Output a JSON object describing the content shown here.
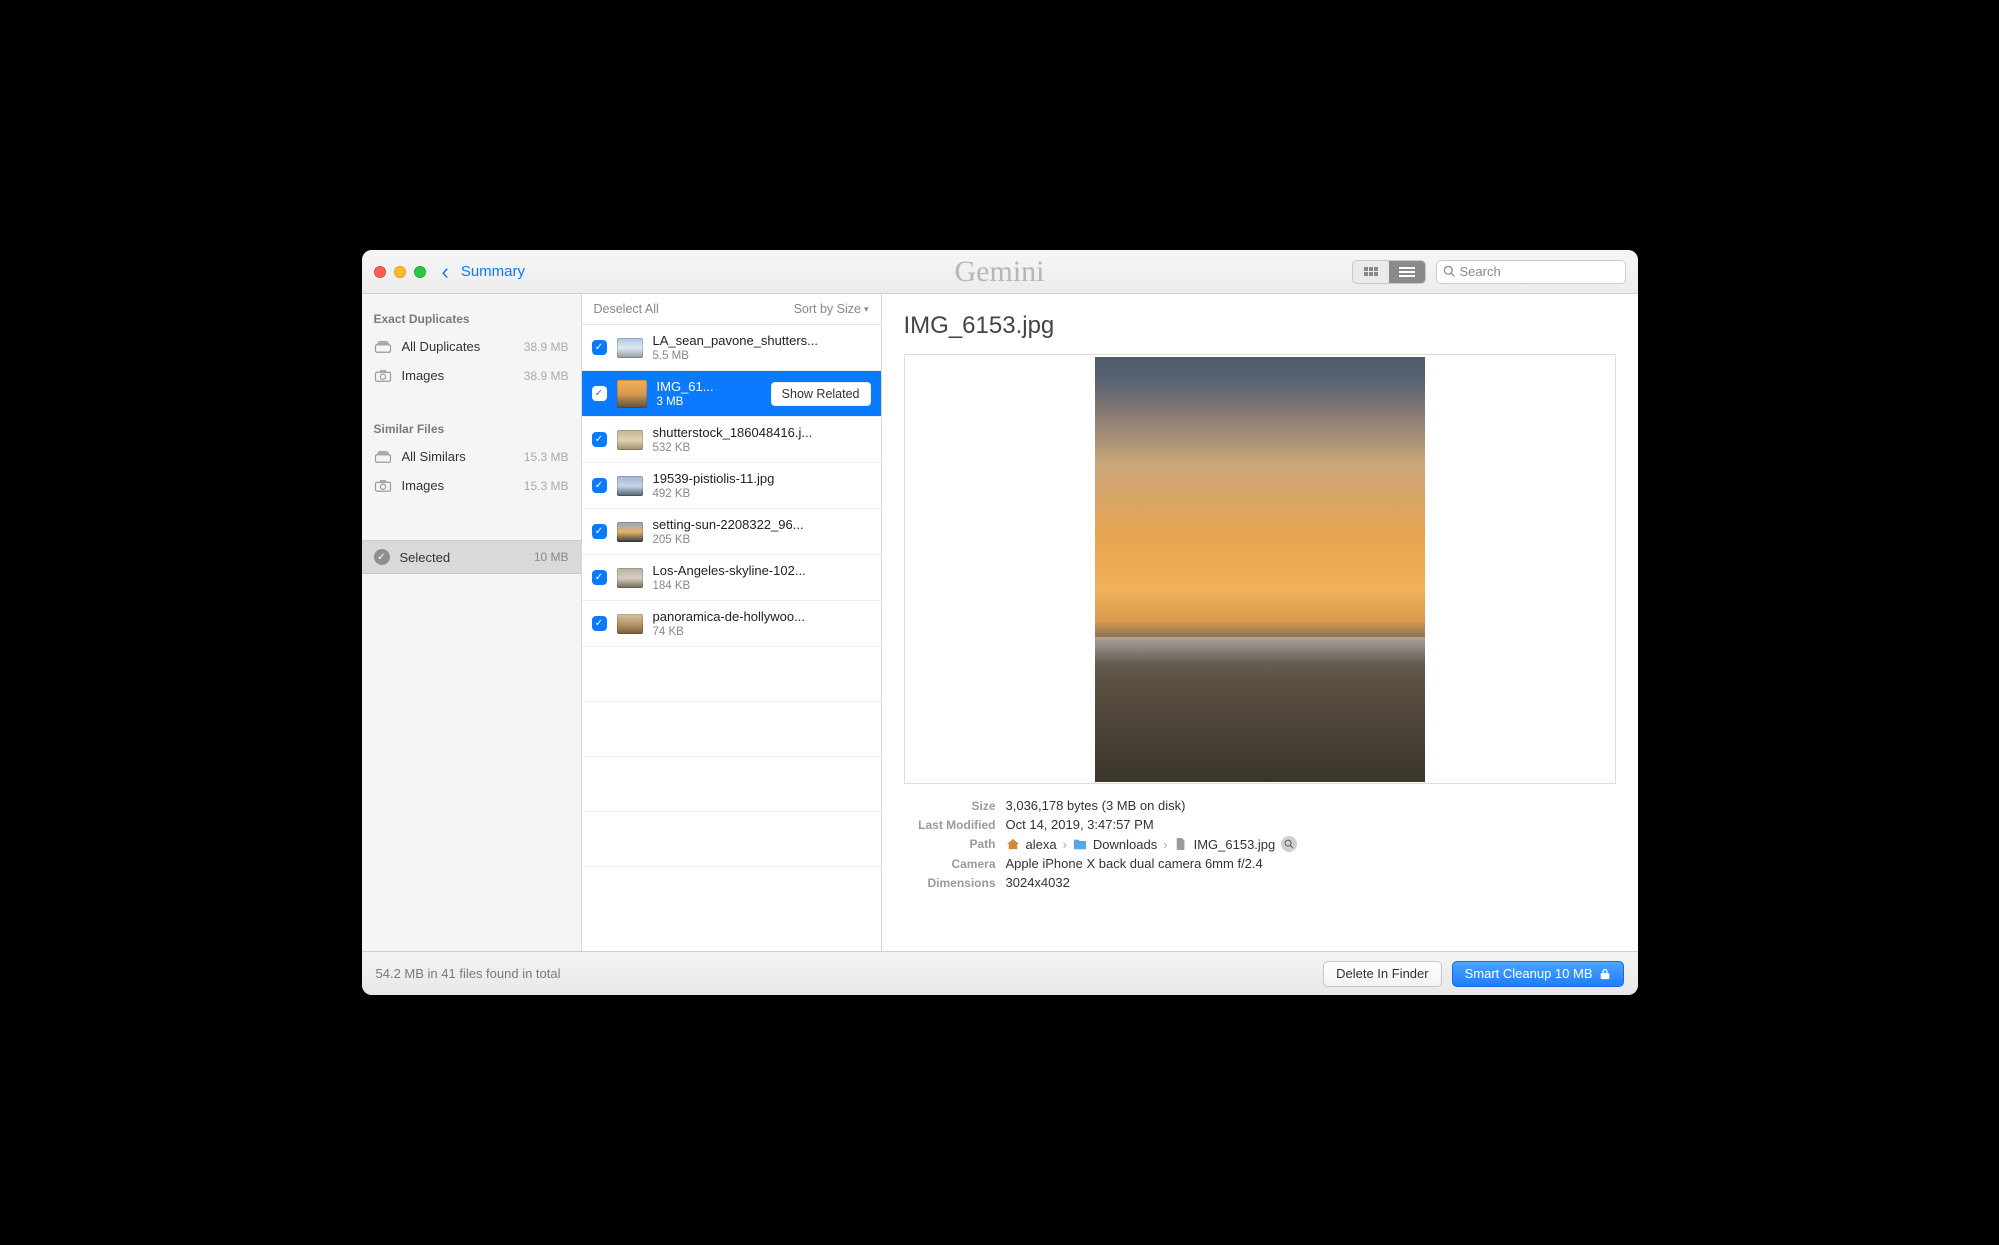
{
  "titlebar": {
    "summary_label": "Summary",
    "brand": "Gemini",
    "search_placeholder": "Search"
  },
  "sidebar": {
    "section_dup": "Exact Duplicates",
    "dup_all_label": "All Duplicates",
    "dup_all_size": "38.9 MB",
    "dup_images_label": "Images",
    "dup_images_size": "38.9 MB",
    "section_sim": "Similar Files",
    "sim_all_label": "All Similars",
    "sim_all_size": "15.3 MB",
    "sim_images_label": "Images",
    "sim_images_size": "15.3 MB",
    "selected_label": "Selected",
    "selected_size": "10 MB"
  },
  "filelist": {
    "deselect_label": "Deselect All",
    "sort_label": "Sort by Size",
    "show_related": "Show Related",
    "items": [
      {
        "name": "LA_sean_pavone_shutters...",
        "size": "5.5 MB"
      },
      {
        "name": "IMG_61...",
        "size": "3 MB"
      },
      {
        "name": "shutterstock_186048416.j...",
        "size": "532 KB"
      },
      {
        "name": "19539-pistiolis-11.jpg",
        "size": "492 KB"
      },
      {
        "name": "setting-sun-2208322_96...",
        "size": "205 KB"
      },
      {
        "name": "Los-Angeles-skyline-102...",
        "size": "184 KB"
      },
      {
        "name": "panoramica-de-hollywoo...",
        "size": "74 KB"
      }
    ]
  },
  "preview": {
    "title": "IMG_6153.jpg",
    "meta": {
      "size_label": "Size",
      "size_value": "3,036,178 bytes (3 MB on disk)",
      "modified_label": "Last Modified",
      "modified_value": "Oct 14, 2019, 3:47:57 PM",
      "path_label": "Path",
      "path_home": "alexa",
      "path_folder": "Downloads",
      "path_file": "IMG_6153.jpg",
      "camera_label": "Camera",
      "camera_value": "Apple iPhone X back dual camera 6mm f/2.4",
      "dim_label": "Dimensions",
      "dim_value": "3024x4032"
    }
  },
  "bottombar": {
    "status": "54.2 MB in 41 files found in total",
    "delete_label": "Delete In Finder",
    "cleanup_label": "Smart Cleanup 10 MB"
  }
}
